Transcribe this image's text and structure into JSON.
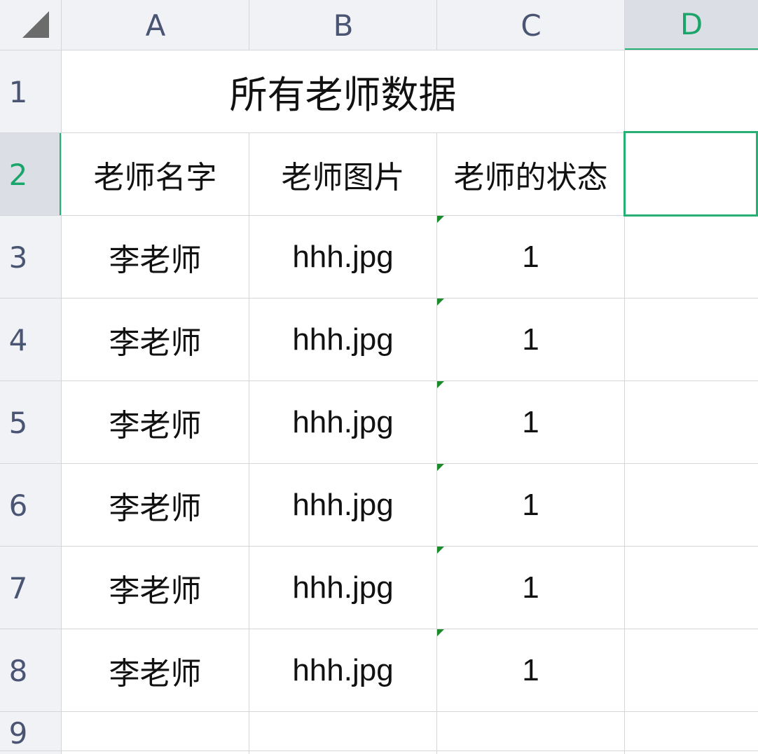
{
  "columns": [
    "A",
    "B",
    "C",
    "D"
  ],
  "rows": [
    "1",
    "2",
    "3",
    "4",
    "5",
    "6",
    "7",
    "8",
    "9"
  ],
  "title": "所有老师数据",
  "headers": [
    "老师名字",
    "老师图片",
    "老师的状态"
  ],
  "data_rows": [
    {
      "name": "李老师",
      "image": "hhh.jpg",
      "status": "1"
    },
    {
      "name": "李老师",
      "image": "hhh.jpg",
      "status": "1"
    },
    {
      "name": "李老师",
      "image": "hhh.jpg",
      "status": "1"
    },
    {
      "name": "李老师",
      "image": "hhh.jpg",
      "status": "1"
    },
    {
      "name": "李老师",
      "image": "hhh.jpg",
      "status": "1"
    },
    {
      "name": "李老师",
      "image": "hhh.jpg",
      "status": "1"
    }
  ],
  "selection": {
    "cell": "D2",
    "active_column": "D",
    "active_row": "2"
  },
  "colors": {
    "accent": "#27b074",
    "header_bg": "#f1f2f6",
    "grid": "#d4d6da"
  }
}
